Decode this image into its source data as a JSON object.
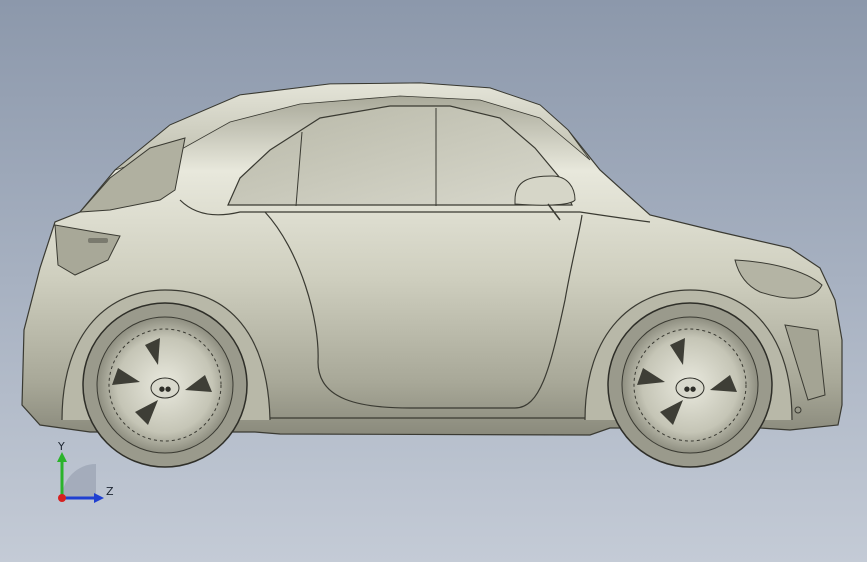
{
  "viewport": {
    "background_top": "#8c98ab",
    "background_bottom": "#c4cbd6",
    "model": {
      "name": "car-model",
      "view": "side",
      "body_color": "#c9c9b7"
    }
  },
  "triad": {
    "y_label": "Y",
    "z_label": "Z",
    "y_color": "#2bb32b",
    "z_color": "#1f3fd1",
    "x_color": "#d62020"
  }
}
